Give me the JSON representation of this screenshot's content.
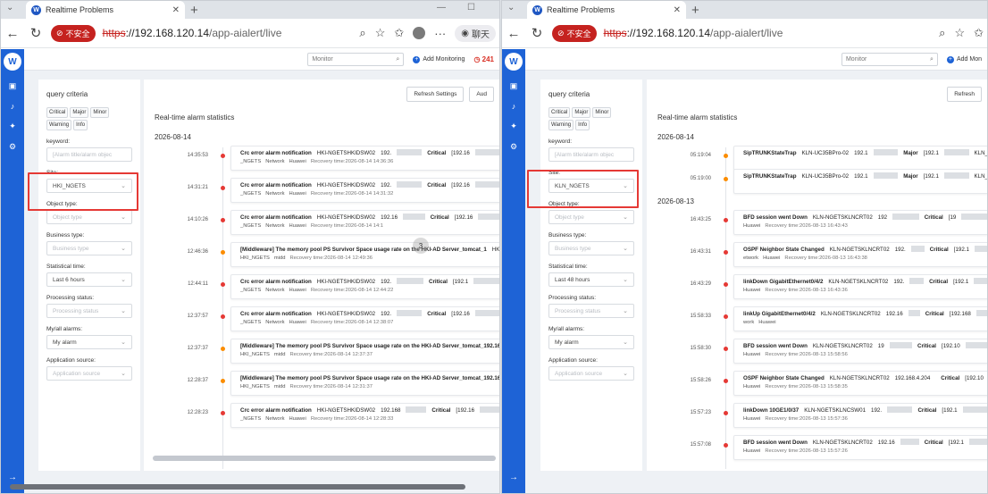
{
  "browser": {
    "tab_title": "Realtime Problems",
    "security_label": "不安全",
    "url_scheme": "https",
    "url_host": "://192.168.120.14",
    "url_path": "/app-aialert/live",
    "chat_label": "聊天"
  },
  "toolbar": {
    "monitor_placeholder": "Monitor",
    "add_monitoring": "Add Monitoring",
    "add_monitoring_short": "Add Mon",
    "alarm_count": "241",
    "refresh": "Refresh Settings",
    "refresh_short": "Refresh",
    "audit": "Aud"
  },
  "query": {
    "title": "query criteria",
    "severities": [
      "Critical",
      "Major",
      "Minor",
      "Warning",
      "Info"
    ],
    "keyword_label": "keyword:",
    "keyword_placeholder": "[Alarm title/alarm objec",
    "site_label": "Site:",
    "object_type_label": "Object type:",
    "object_type_placeholder": "Object type",
    "business_type_label": "Business type:",
    "business_type_placeholder": "Business type",
    "stat_time_label": "Statistical time:",
    "processing_label": "Processing status:",
    "processing_placeholder": "Processing status",
    "myall_label": "My/all alarms:",
    "myall_value": "My alarm",
    "appsrc_label": "Application source:",
    "appsrc_placeholder": "Application source"
  },
  "main": {
    "title": "Real-time alarm statistics"
  },
  "win1": {
    "site_value": "HKI_NGETS",
    "stat_time_value": "Last 6 hours",
    "date": "2026-08-14",
    "cursor_label": "3",
    "events": [
      {
        "time": "14:35:53",
        "dot": "#e53935",
        "name": "Crc error alarm notification",
        "obj": "HKI-NGETSHKIDSW02",
        "ip": "192.",
        "sev": "Critical",
        "ip2": "[192.16",
        "r2a": "_NGETS",
        "r2b": "Network",
        "r2c": "Huawei",
        "rt": "Recovery time:2026-08-14 14:36:36"
      },
      {
        "time": "14:31:21",
        "dot": "#e53935",
        "name": "Crc error alarm notification",
        "obj": "HKI-NGETSHKIDSW02",
        "ip": "192.",
        "sev": "Critical",
        "ip2": "[192.16",
        "r2a": "_NGETS",
        "r2b": "Network",
        "r2c": "Huawei",
        "rt": "Recovery time:2026-08-14 14:31:32"
      },
      {
        "time": "14:10:26",
        "dot": "#e53935",
        "name": "Crc error alarm notification",
        "obj": "HKI-NGETSHKIDSW02",
        "ip": "192.16",
        "sev": "Critical",
        "ip2": "[192.16",
        "r2a": "_NGETS",
        "r2b": "Network",
        "r2c": "Huawei",
        "rt": "Recovery time:2026-08-14 14:1"
      },
      {
        "time": "12:46:36",
        "dot": "#fb8c00",
        "name": "[Middleware] The memory pool PS Survivor Space usage rate on the HKI-AD Server_tomcat_1",
        "obj": "HKI-AD Server_tomcat_192.16",
        "ip": "192.168.",
        "sev": "Major",
        "ip2": "[localhost]",
        "r2a": "HKI_NGETS",
        "r2b": "midd",
        "r2c": "",
        "rt": "Recovery time:2026-08-14 12:49:36"
      },
      {
        "time": "12:44:11",
        "dot": "#e53935",
        "name": "Crc error alarm notification",
        "obj": "HKI-NGETSHKIDSW02",
        "ip": "192.",
        "sev": "Critical",
        "ip2": "[192.1",
        "r2a": "_NGETS",
        "r2b": "Network",
        "r2c": "Huawei",
        "rt": "Recovery time:2026-08-14 12:44:22"
      },
      {
        "time": "12:37:57",
        "dot": "#e53935",
        "name": "Crc error alarm notification",
        "obj": "HKI-NGETSHKIDSW02",
        "ip": "192.",
        "sev": "Critical",
        "ip2": "[192.16",
        "r2a": "_NGETS",
        "r2b": "Network",
        "r2c": "Huawei",
        "rt": "Recovery time:2026-08-14 12:38:07"
      },
      {
        "time": "12:37:37",
        "dot": "#fb8c00",
        "name": "[Middleware] The memory pool PS Survivor Space usage rate on the HKI-AD Server_tomcat_192.168",
        "obj": "HKI-AD Server_tomcat_192.16",
        "ip": "192.",
        "sev": "Major",
        "ip2": "[localhost]",
        "r2a": "HKI_NGETS",
        "r2b": "midd",
        "r2c": "",
        "rt": "Recovery time:2026-08-14 12:37:37"
      },
      {
        "time": "12:28:37",
        "dot": "#fb8c00",
        "name": "[Middleware] The memory pool PS Survivor Space usage rate on the HKI-AD Server_tomcat_192.168",
        "obj": "HKI-AD Server_tomcat_192.1",
        "ip": "192.",
        "sev": "Major",
        "ip2": "[localhost]",
        "r2a": "HKI_NGETS",
        "r2b": "midd",
        "r2c": "",
        "rt": "Recovery time:2026-08-14 12:31:37"
      },
      {
        "time": "12:28:23",
        "dot": "#e53935",
        "name": "Crc error alarm notification",
        "obj": "HKI-NGETSHKIDSW02",
        "ip": "192.168",
        "sev": "Critical",
        "ip2": "[192.16",
        "r2a": "_NGETS",
        "r2b": "Network",
        "r2c": "Huawei",
        "rt": "Recovery time:2026-08-14 12:28:33"
      }
    ]
  },
  "win2": {
    "site_value": "KLN_NGETS",
    "stat_time_value": "Last 48 hours",
    "date1": "2026-08-14",
    "date2": "2026-08-13",
    "events1": [
      {
        "time": "05:19:04",
        "dot": "#fb8c00",
        "name": "SipTRUNKStateTrap",
        "obj": "KLN-UC35BPro-02",
        "ip": "192.1",
        "sev": "Major",
        "ip2": "[192.1",
        "r2a": "",
        "r2b": "",
        "r2c": "",
        "rt": "",
        "tail": "KLN_"
      },
      {
        "time": "05:19:00",
        "dot": "#fb8c00",
        "name": "SipTRUNKStateTrap",
        "obj": "KLN-UC35BPro-02",
        "ip": "192.1",
        "sev": "Major",
        "ip2": "[192.1",
        "r2a": "",
        "r2b": "",
        "r2c": "",
        "rt": "",
        "tail": "KLN_"
      }
    ],
    "events2": [
      {
        "time": "16:43:25",
        "dot": "#e53935",
        "name": "BFD session went Down",
        "obj": "KLN-NGETSKLNCRT02",
        "ip": "192",
        "sev": "Critical",
        "ip2": "[19",
        "r2a": "Huawei",
        "r2b": "",
        "r2c": "",
        "rt": "Recovery time:2026-08-13 16:43:43"
      },
      {
        "time": "16:43:31",
        "dot": "#e53935",
        "name": "OSPF Neighbor State Changed",
        "obj": "KLN-NGETSKLNCRT02",
        "ip": "192.",
        "sev": "Critical",
        "ip2": "[192.1",
        "r2a": "etwork",
        "r2b": "Huawei",
        "r2c": "",
        "rt": "Recovery time:2026-08-13 16:43:38"
      },
      {
        "time": "16:43:29",
        "dot": "#e53935",
        "name": "linkDown GigabitEthernet0/4/2",
        "obj": "KLN-NGETSKLNCRT02",
        "ip": "192.",
        "sev": "Critical",
        "ip2": "[192.1",
        "r2a": "Huawei",
        "r2b": "",
        "r2c": "",
        "rt": "Recovery time:2026-08-13 16:43:36"
      },
      {
        "time": "15:58:33",
        "dot": "#e53935",
        "name": "linkUp GigabitEthernet0/4/2",
        "obj": "KLN-NGETSKLNCRT02",
        "ip": "192.16",
        "sev": "Critical",
        "ip2": "[192.168",
        "r2a": "work",
        "r2b": "Huawei",
        "r2c": "",
        "rt": ""
      },
      {
        "time": "15:58:30",
        "dot": "#e53935",
        "name": "BFD session went Down",
        "obj": "KLN-NGETSKLNCRT02",
        "ip": "19",
        "sev": "Critical",
        "ip2": "[192.10",
        "r2a": "Huawei",
        "r2b": "",
        "r2c": "",
        "rt": "Recovery time:2026-08-13 15:58:56"
      },
      {
        "time": "15:58:26",
        "dot": "#e53935",
        "name": "OSPF Neighbor State Changed",
        "obj": "KLN-NGETSKLNCRT02",
        "ip": "192.168.4.204",
        "sev": "Critical",
        "ip2": "[192.10",
        "r2a": "Huawei",
        "r2b": "",
        "r2c": "",
        "rt": "Recovery time:2026-08-13 15:58:35"
      },
      {
        "time": "15:57:23",
        "dot": "#e53935",
        "name": "linkDown 10GE1/0/37",
        "obj": "KLN-NGETSKLNCSW01",
        "ip": "192.",
        "sev": "Critical",
        "ip2": "[192.1",
        "r2a": "Huawei",
        "r2b": "",
        "r2c": "",
        "rt": "Recovery time:2026-08-13 15:57:36"
      },
      {
        "time": "15:57:08",
        "dot": "#e53935",
        "name": "BFD session went Down",
        "obj": "KLN-NGETSKLNCRT02",
        "ip": "192.16",
        "sev": "Critical",
        "ip2": "[192.1",
        "r2a": "Huawei",
        "r2b": "",
        "r2c": "",
        "rt": "Recovery time:2026-08-13 15:57:26"
      }
    ]
  },
  "colors": {
    "accent": "#1e63d6",
    "critical": "#e53935",
    "major": "#fb8c00",
    "highlight_frame": "#e53935"
  }
}
